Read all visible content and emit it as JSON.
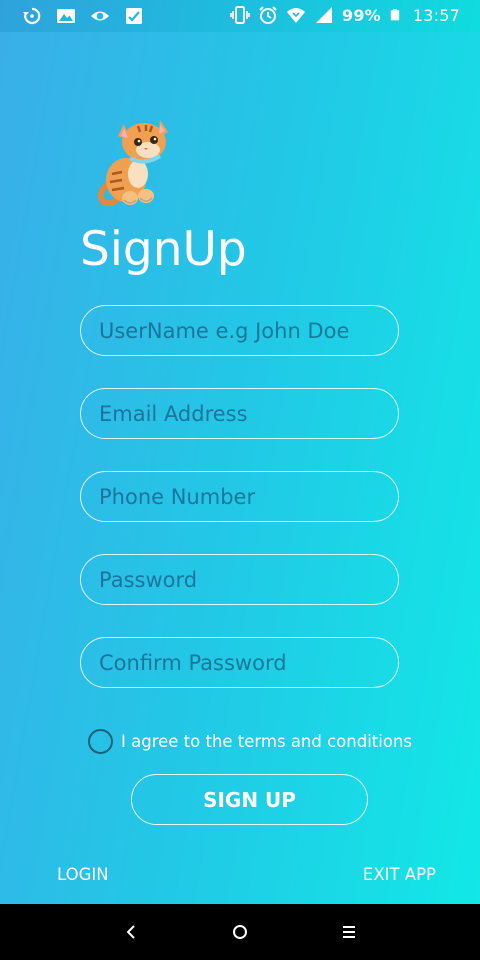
{
  "status_bar": {
    "left_icons": [
      "sync-icon",
      "image-icon",
      "eye-icon",
      "checkbox-image-icon"
    ],
    "right_icons": [
      "vibrate-icon",
      "alarm-icon",
      "wifi-icon",
      "signal-icon",
      "battery-icon"
    ],
    "battery_percent": "99%",
    "time": "13:57"
  },
  "logo": {
    "icon": "cat-logo"
  },
  "title": "SignUp",
  "form": {
    "username_placeholder": "UserName e.g John Doe",
    "email_placeholder": "Email Address",
    "phone_placeholder": "Phone Number",
    "password_placeholder": "Password",
    "confirm_password_placeholder": "Confirm Password",
    "agree_label": "I agree to the terms and conditions",
    "agree_checked": false,
    "signup_label": "SIGN UP"
  },
  "footer": {
    "login_label": "LOGIN",
    "exit_label": "EXIT APP"
  },
  "nav_bar": {
    "icons": [
      "back-icon",
      "home-icon",
      "menu-icon"
    ]
  },
  "colors": {
    "gradient_start": "#3aaee8",
    "gradient_end": "#12e8e6",
    "radio_border": "#1b5f7a"
  }
}
